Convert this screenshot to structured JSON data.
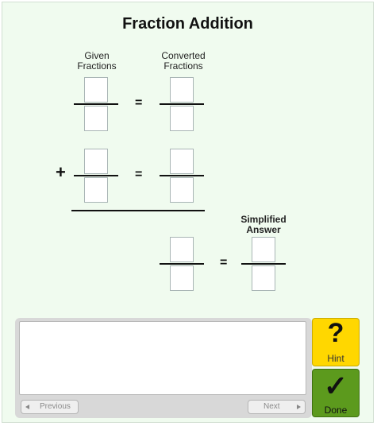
{
  "title": "Fraction Addition",
  "headers": {
    "given": [
      "Given",
      "Fractions"
    ],
    "converted": [
      "Converted",
      "Fractions"
    ],
    "simplified": [
      "Simplified",
      "Answer"
    ]
  },
  "symbols": {
    "plus": "+",
    "equals": "="
  },
  "feedback": {
    "text": ""
  },
  "navigation": {
    "previous": "Previous",
    "next": "Next"
  },
  "buttons": {
    "hint_glyph": "?",
    "hint": "Hint",
    "done_glyph": "✓",
    "done": "Done"
  },
  "colors": {
    "background": "#f0fbef",
    "hint": "#ffd700",
    "done": "#5c9a1d"
  }
}
